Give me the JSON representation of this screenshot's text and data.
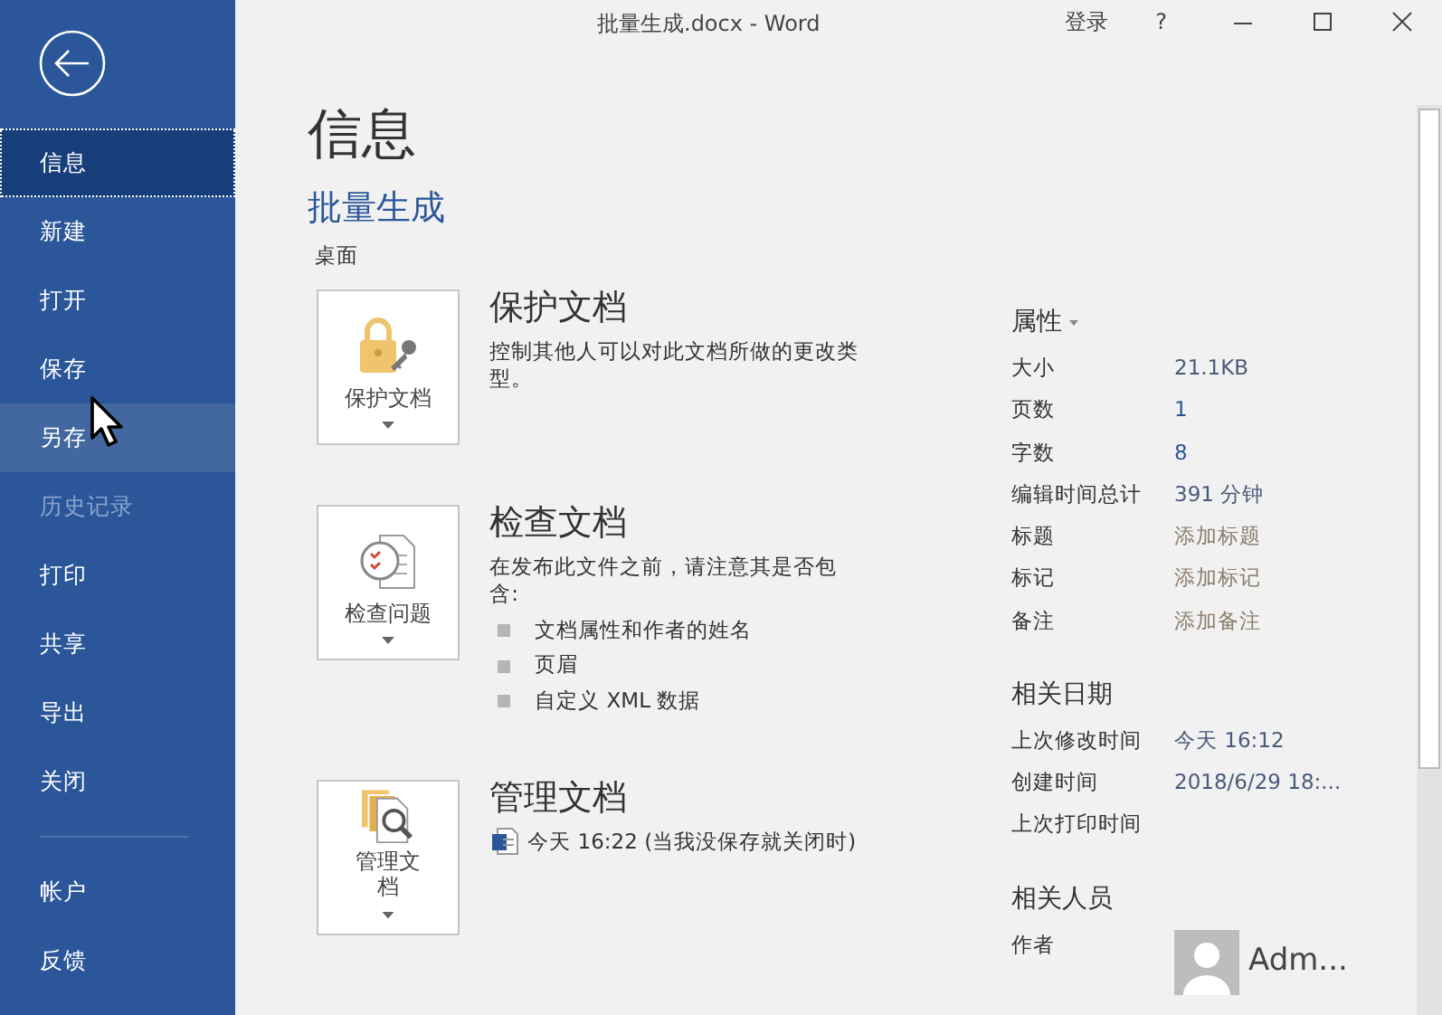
{
  "window": {
    "title": "批量生成.docx  -  Word",
    "sign_in": "登录",
    "help": "?"
  },
  "sidebar": {
    "items": [
      {
        "label": "信息",
        "selected": true,
        "hovered": false,
        "disabled": false,
        "divider_before": false
      },
      {
        "label": "新建",
        "selected": false,
        "hovered": false,
        "disabled": false,
        "divider_before": false
      },
      {
        "label": "打开",
        "selected": false,
        "hovered": false,
        "disabled": false,
        "divider_before": false
      },
      {
        "label": "保存",
        "selected": false,
        "hovered": false,
        "disabled": false,
        "divider_before": false
      },
      {
        "label": "另存",
        "selected": false,
        "hovered": true,
        "disabled": false,
        "divider_before": false
      },
      {
        "label": "历史记录",
        "selected": false,
        "hovered": false,
        "disabled": true,
        "divider_before": false
      },
      {
        "label": "打印",
        "selected": false,
        "hovered": false,
        "disabled": false,
        "divider_before": false
      },
      {
        "label": "共享",
        "selected": false,
        "hovered": false,
        "disabled": false,
        "divider_before": false
      },
      {
        "label": "导出",
        "selected": false,
        "hovered": false,
        "disabled": false,
        "divider_before": false
      },
      {
        "label": "关闭",
        "selected": false,
        "hovered": false,
        "disabled": false,
        "divider_before": false
      },
      {
        "label": "帐户",
        "selected": false,
        "hovered": false,
        "disabled": false,
        "divider_before": true
      },
      {
        "label": "反馈",
        "selected": false,
        "hovered": false,
        "disabled": false,
        "divider_before": false
      }
    ]
  },
  "page": {
    "heading": "信息",
    "document_name": "批量生成",
    "location": "桌面"
  },
  "sections": [
    {
      "kind": "protect",
      "button_label": "保护文档",
      "title": "保护文档",
      "description": "控制其他人可以对此文档所做的更改类型。"
    },
    {
      "kind": "inspect",
      "button_label": "检查问题",
      "title": "检查文档",
      "description": "在发布此文件之前，请注意其是否包含:",
      "bullets": [
        "文档属性和作者的姓名",
        "页眉",
        "自定义 XML 数据"
      ]
    },
    {
      "kind": "manage",
      "button_label": "管理文档",
      "title": "管理文档",
      "versions": [
        "今天 16:22 (当我没保存就关闭时)"
      ]
    }
  ],
  "properties": {
    "heading": "属性",
    "rows": [
      {
        "label": "大小",
        "value": "21.1KB",
        "kind": "text"
      },
      {
        "label": "页数",
        "value": "1",
        "kind": "link"
      },
      {
        "label": "字数",
        "value": "8",
        "kind": "link"
      },
      {
        "label": "编辑时间总计",
        "value": "391 分钟",
        "kind": "text"
      },
      {
        "label": "标题",
        "value": "添加标题",
        "kind": "placeholder"
      },
      {
        "label": "标记",
        "value": "添加标记",
        "kind": "placeholder"
      },
      {
        "label": "备注",
        "value": "添加备注",
        "kind": "placeholder"
      }
    ]
  },
  "related_dates": {
    "heading": "相关日期",
    "rows": [
      {
        "label": "上次修改时间",
        "value": "今天 16:12"
      },
      {
        "label": "创建时间",
        "value": "2018/6/29 18:..."
      },
      {
        "label": "上次打印时间",
        "value": ""
      }
    ]
  },
  "related_people": {
    "heading": "相关人员",
    "rows": [
      {
        "label": "作者",
        "value": "Adm..."
      }
    ]
  }
}
